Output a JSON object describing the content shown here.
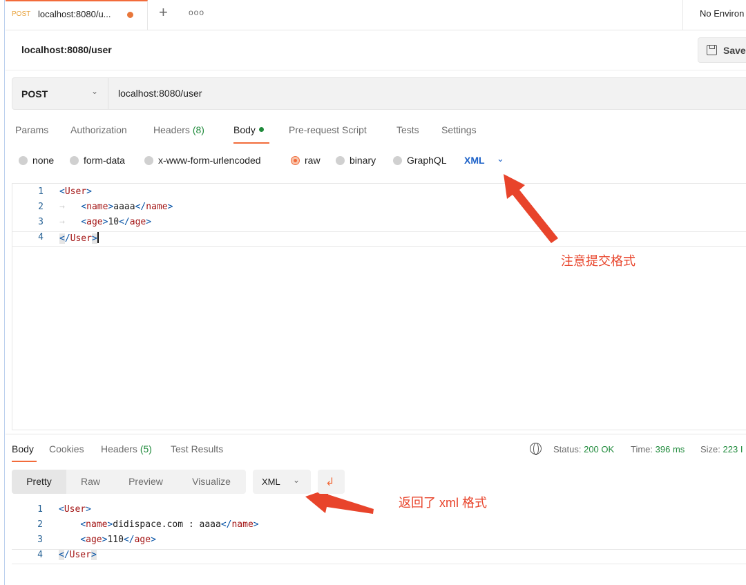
{
  "tab": {
    "method": "POST",
    "title": "localhost:8080/u...",
    "plus": "+",
    "more": "ooo"
  },
  "environment": {
    "label": "No Environ"
  },
  "request": {
    "name": "localhost:8080/user",
    "save_label": "Save",
    "method": "POST",
    "url": "localhost:8080/user"
  },
  "request_tabs": {
    "params": "Params",
    "authorization": "Authorization",
    "headers": "Headers",
    "headers_count": "(8)",
    "body": "Body",
    "pre_request": "Pre-request Script",
    "tests": "Tests",
    "settings": "Settings"
  },
  "body_types": {
    "none": "none",
    "form_data": "form-data",
    "urlencoded": "x-www-form-urlencoded",
    "raw": "raw",
    "binary": "binary",
    "graphql": "GraphQL",
    "format": "XML"
  },
  "request_body": {
    "lines": [
      {
        "num": "1",
        "open": "<User>"
      },
      {
        "num": "2",
        "tag": "name",
        "value": "aaaa"
      },
      {
        "num": "3",
        "tag": "age",
        "value": "10"
      },
      {
        "num": "4",
        "close": "</User>"
      }
    ]
  },
  "annotations": {
    "format_note": "注意提交格式",
    "response_note": "返回了 xml 格式",
    "arrow_color": "#e8442b"
  },
  "response_tabs": {
    "body": "Body",
    "cookies": "Cookies",
    "headers": "Headers",
    "headers_count": "(5)",
    "test_results": "Test Results"
  },
  "response_status": {
    "status_label": "Status:",
    "status_value": "200 OK",
    "time_label": "Time:",
    "time_value": "396 ms",
    "size_label": "Size:",
    "size_value": "223 I"
  },
  "response_view": {
    "pretty": "Pretty",
    "raw": "Raw",
    "preview": "Preview",
    "visualize": "Visualize",
    "format": "XML"
  },
  "response_body": {
    "lines": [
      {
        "num": "1",
        "open": "<User>"
      },
      {
        "num": "2",
        "tag": "name",
        "value": "didispace.com : aaaa"
      },
      {
        "num": "3",
        "tag": "age",
        "value": "110"
      },
      {
        "num": "4",
        "close": "</User>"
      }
    ]
  },
  "colors": {
    "accent": "#f26b3a",
    "success": "#1f8a3b",
    "link": "#1d62c8"
  }
}
